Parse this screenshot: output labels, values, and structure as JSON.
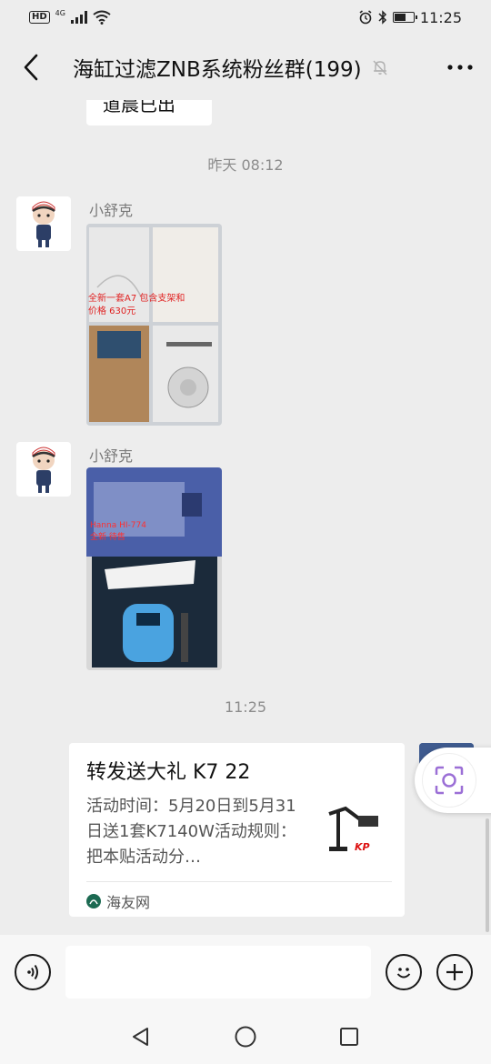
{
  "status_bar": {
    "badge": "HD",
    "network": "4G",
    "time": "11:25",
    "battery_level": 0.6
  },
  "header": {
    "title": "海缸过滤ZNB系统粉丝群(199)"
  },
  "chat": {
    "partial_message": "道晨已出",
    "timestamp_yesterday": "昨天 08:12",
    "timestamp_today": "11:25",
    "messages": [
      {
        "sender": "小舒克",
        "photo_overlay_lines": [
          "全新一套A7  包含支架和",
          "价格  630元"
        ]
      },
      {
        "sender": "小舒克",
        "photo_overlay_lines": [
          "Hanna HI-774",
          "全新 待售"
        ]
      }
    ],
    "link_card": {
      "title": "转发送大礼 K7 22",
      "description": "活动时间：5月20日到5月31日送1套K7140W活动规则：把本贴活动分…",
      "source": "海友网",
      "thumb_logo_text": "KP"
    }
  },
  "input_bar": {
    "placeholder": ""
  },
  "colors": {
    "background": "#ededed",
    "bubble": "#ffffff",
    "timestamp": "#8c8c8c",
    "scan_accent": "#9b6fd6"
  },
  "icons": {
    "back": "chevron-left-icon",
    "mute": "bell-off-icon",
    "more": "ellipsis-icon",
    "voice": "voice-icon",
    "emoji": "smiley-icon",
    "add": "plus-icon",
    "scan": "scan-icon"
  }
}
